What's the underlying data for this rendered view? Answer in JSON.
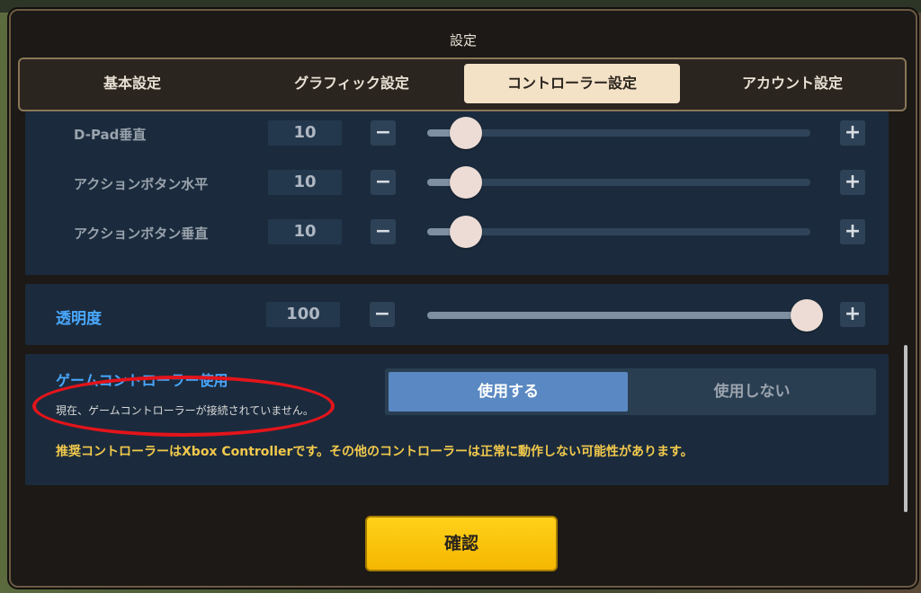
{
  "dialog": {
    "title": "設定"
  },
  "tabs": [
    {
      "label": "基本設定",
      "active": false
    },
    {
      "label": "グラフィック設定",
      "active": false
    },
    {
      "label": "コントローラー設定",
      "active": true
    },
    {
      "label": "アカウント設定",
      "active": false
    }
  ],
  "sliders": [
    {
      "label": "D-Pad垂直",
      "value": "10",
      "level": 0.1,
      "minus": "−",
      "plus": "+"
    },
    {
      "label": "アクションボタン水平",
      "value": "10",
      "level": 0.1,
      "minus": "−",
      "plus": "+"
    },
    {
      "label": "アクションボタン垂直",
      "value": "10",
      "level": 0.1,
      "minus": "−",
      "plus": "+"
    }
  ],
  "transparency": {
    "label": "透明度",
    "value": "100",
    "level": 1.0,
    "minus": "−",
    "plus": "+"
  },
  "controller": {
    "title": "ゲームコントローラー使用",
    "status": "現在、ゲームコントローラーが接続されていません。",
    "options": {
      "use": "使用する",
      "not_use": "使用しない",
      "selected": "使用する"
    },
    "recommendation": "推奨コントローラーはXbox Controllerです。その他のコントローラーは正常に動作しない可能性があります。"
  },
  "confirm_label": "確認",
  "colors": {
    "accent_blue": "#4aa8ff",
    "confirm_yellow": "#ffd11a",
    "annotation_red": "#e3141b"
  }
}
